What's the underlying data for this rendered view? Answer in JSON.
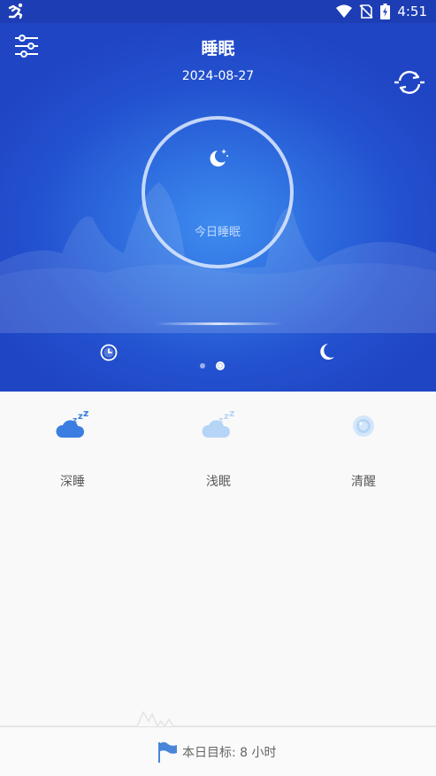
{
  "status_bar": {
    "time": "4:51",
    "icons": [
      "running-icon",
      "wifi-icon",
      "no-sim-icon",
      "battery-charging-icon"
    ]
  },
  "header": {
    "title": "睡眠",
    "date": "2024-08-27",
    "settings_icon": "sliders-icon",
    "sync_icon": "sync-icon"
  },
  "hero": {
    "ring_label": "今日睡眠",
    "ring_icon": "moon-star-icon",
    "left_icon": "clock-icon",
    "right_icon": "moon-icon",
    "pages": 2,
    "active_page": 2
  },
  "stats": [
    {
      "label": "深睡",
      "icon": "deep-sleep-cloud-icon",
      "color": "#3b7de0"
    },
    {
      "label": "浅眠",
      "icon": "light-sleep-cloud-icon",
      "color": "#b6d4f5"
    },
    {
      "label": "清醒",
      "icon": "awake-eye-icon",
      "color": "#d4e6f9"
    }
  ],
  "goal": {
    "text": "本日目标: 8 小时",
    "icon": "flag-icon"
  },
  "colors": {
    "primary": "#2351cf",
    "status_bar": "#1d3db4",
    "deep": "#3b7de0"
  }
}
